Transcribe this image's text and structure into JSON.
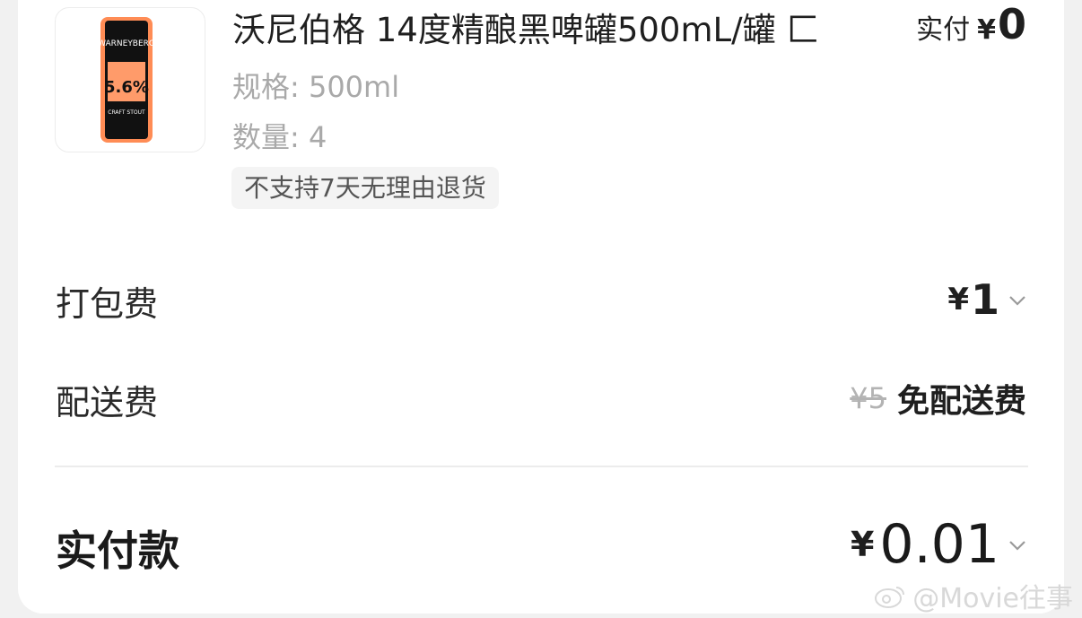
{
  "product": {
    "title": "沃尼伯格 14度精酿黑啤罐500mL/罐 匚",
    "paid_label": "实付",
    "paid_symbol": "¥",
    "paid_amount": "0",
    "spec": "规格: 500ml",
    "quantity": "数量: 4",
    "return_policy_tag": "不支持7天无理由退货",
    "image": {
      "brand_text": "WARNEYBERG",
      "abv_text": "5.6%",
      "style_text": "CRAFT STOUT"
    }
  },
  "fees": {
    "packaging": {
      "label": "打包费",
      "symbol": "¥",
      "amount": "1"
    },
    "delivery": {
      "label": "配送费",
      "original_price": "¥5",
      "status": "免配送费"
    }
  },
  "total": {
    "label": "实付款",
    "symbol": "¥",
    "amount": "0.01"
  },
  "watermark": {
    "text": "@Movie往事"
  },
  "colors": {
    "background": "#f1f1f1",
    "card": "#ffffff",
    "text_primary": "#1f1f1f",
    "text_secondary": "#a9a9a9",
    "strike": "#b3b3b3",
    "tag_bg": "#f4f4f4"
  },
  "icons": {
    "chevron": "chevron-down-icon",
    "watermark": "weibo-icon"
  }
}
